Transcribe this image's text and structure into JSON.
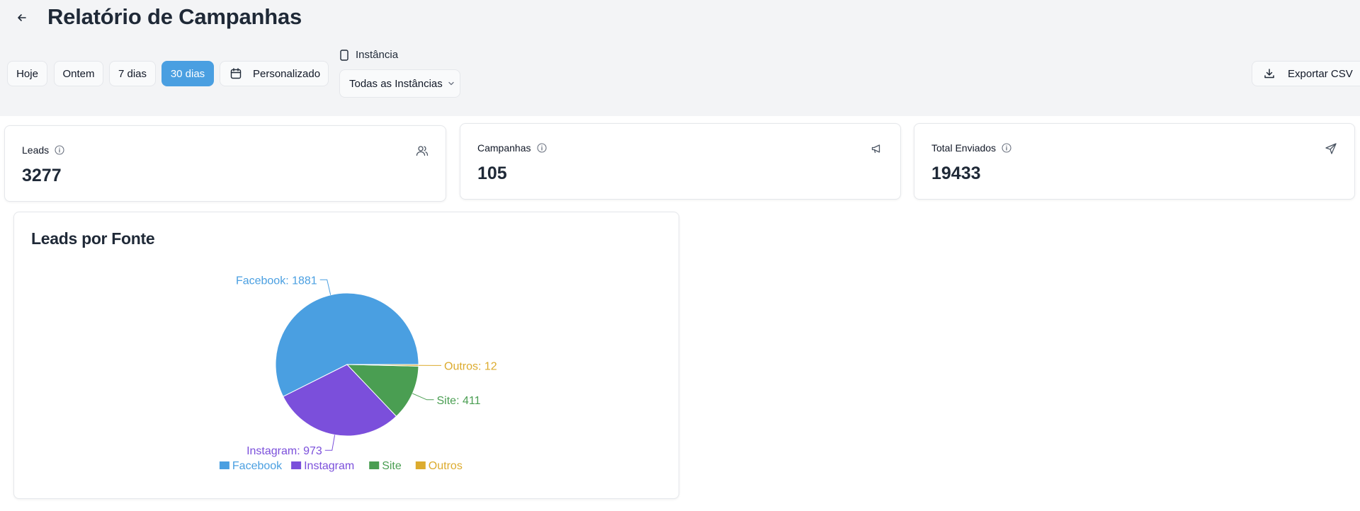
{
  "header": {
    "title": "Relatório de Campanhas",
    "back_icon": "arrow-left-icon"
  },
  "filters": {
    "periods": [
      "Hoje",
      "Ontem",
      "7 dias",
      "30 dias"
    ],
    "active_period": "30 dias",
    "custom_label": "Personalizado",
    "instance_label": "Instância",
    "instance_value": "Todas as Instâncias",
    "export_label": "Exportar CSV"
  },
  "stats": [
    {
      "label": "Leads",
      "value": "3277",
      "icon": "users-icon"
    },
    {
      "label": "Campanhas",
      "value": "105",
      "icon": "megaphone-icon"
    },
    {
      "label": "Total Enviados",
      "value": "19433",
      "icon": "send-icon"
    }
  ],
  "colors": {
    "accent": "#4a9fe1",
    "facebook": "#4a9fe1",
    "instagram": "#7b4fdb",
    "site": "#4a9e52",
    "outros": "#dcab2e"
  },
  "chart_data": {
    "type": "pie",
    "title": "Leads por Fonte",
    "categories": [
      "Facebook",
      "Instagram",
      "Site",
      "Outros"
    ],
    "values": [
      1881,
      973,
      411,
      12
    ],
    "data_labels": [
      "Facebook: 1881",
      "Instagram: 973",
      "Site: 411",
      "Outros: 12"
    ],
    "colors": [
      "#4a9fe1",
      "#7b4fdb",
      "#4a9e52",
      "#dcab2e"
    ],
    "legend_position": "bottom"
  }
}
